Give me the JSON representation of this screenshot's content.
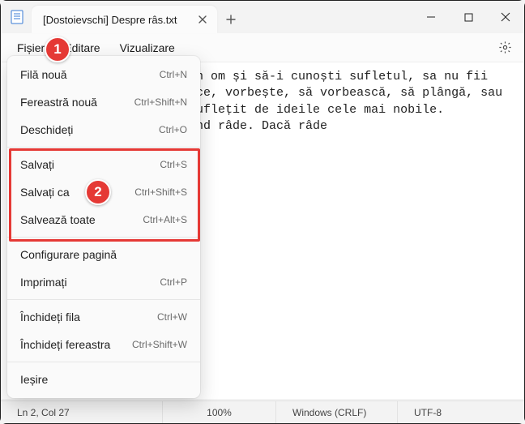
{
  "titlebar": {
    "tab_title": "[Dostoievschi] Despre râs.txt"
  },
  "menubar": {
    "file": "Fișier",
    "edit": "Editare",
    "view": "Vizualizare"
  },
  "editor": {
    "content": "Dacă vrei să descifrezi un om și să-i cunoști sufletul, sa nu fii atent la felul în care tace, vorbește, să vorbească, să plângă, sau la felul în care este însuflețit de ideile cele mai nobile. Privește-l mai degrabă când râde. Dacă râde"
  },
  "dropdown": {
    "items": [
      {
        "label": "Filă nouă",
        "shortcut": "Ctrl+N"
      },
      {
        "label": "Fereastră nouă",
        "shortcut": "Ctrl+Shift+N"
      },
      {
        "label": "Deschideți",
        "shortcut": "Ctrl+O"
      },
      {
        "sep": true
      },
      {
        "label": "Salvați",
        "shortcut": "Ctrl+S"
      },
      {
        "label": "Salvați ca",
        "shortcut": "Ctrl+Shift+S"
      },
      {
        "label": "Salvează toate",
        "shortcut": "Ctrl+Alt+S"
      },
      {
        "sep": true
      },
      {
        "label": "Configurare pagină",
        "shortcut": ""
      },
      {
        "label": "Imprimați",
        "shortcut": "Ctrl+P"
      },
      {
        "sep": true
      },
      {
        "label": "Închideți fila",
        "shortcut": "Ctrl+W"
      },
      {
        "label": "Închideți fereastra",
        "shortcut": "Ctrl+Shift+W"
      },
      {
        "sep": true
      },
      {
        "label": "Ieșire",
        "shortcut": ""
      }
    ]
  },
  "statusbar": {
    "pos": "Ln 2, Col 27",
    "zoom": "100%",
    "lineend": "Windows (CRLF)",
    "encoding": "UTF-8"
  },
  "badges": {
    "b1": "1",
    "b2": "2"
  }
}
